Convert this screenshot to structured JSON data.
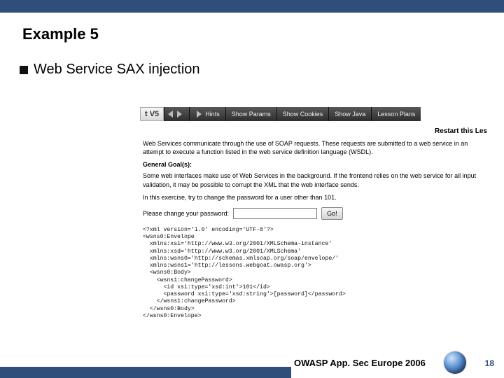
{
  "title": "Example 5",
  "bullet": "Web Service SAX injection",
  "nav": {
    "vs": "t V5",
    "hints": "Hints",
    "showParams": "Show Params",
    "showCookies": "Show Cookies",
    "showJava": "Show Java",
    "lessonPlans": "Lesson Plans"
  },
  "restart": "Restart this Les",
  "intro": "Web Services communicate through the use of SOAP requests. These requests are submitted to a web service in an attempt to execute a function listed in the web service definition language (WSDL).",
  "goalsHeading": "General Goal(s):",
  "goals1": "Some web interfaces make use of Web Services in the background. If the frontend relies on the web service for all input validation, it may be possible to corrupt the XML that the web interface sends.",
  "goals2": "In this exercise, try to change the password for a user other than 101.",
  "formLabel": "Please change your password:",
  "goBtn": "Go!",
  "passwordValue": "",
  "xml": "<?xml version='1.0' encoding='UTF-8'?>\n<wsns0:Envelope\n  xmlns:xsi='http://www.w3.org/2001/XMLSchema-instance'\n  xmlns:xsd='http://www.w3.org/2001/XMLSchema'\n  xmlns:wsns0='http://schemas.xmlsoap.org/soap/envelope/'\n  xmlns:wsns1='http://lessons.webgoat.owasp.org'>\n  <wsns0:Body>\n    <wsns1:changePassword>\n      <id xsi:type='xsd:int'>101</id>\n      <password xsi:type='xsd:string'>[password]</password>\n    </wsns1:changePassword>\n  </wsns0:Body>\n</wsns0:Envelope>",
  "footer": "OWASP App. Sec Europe 2006",
  "pagenum": "18"
}
